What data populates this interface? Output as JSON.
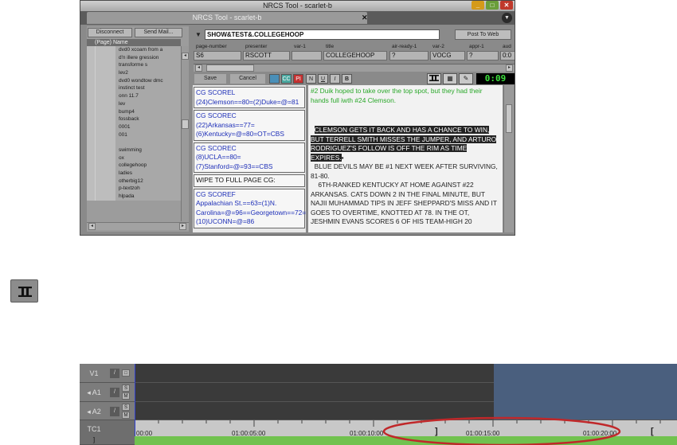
{
  "nrcs": {
    "window_title": "NRCS Tool - scarlet-b",
    "tab_title": "NRCS Tool - scarlet-b",
    "tab_close": "✕",
    "tab_menu": "▼",
    "buttons": {
      "disconnect": "Disconnect",
      "send_mail": "Send Mail..."
    },
    "queue_column_header": "(Page) Name",
    "queue_items": [
      "dvd0 xcoam from a",
      "d'n illere gression",
      "transforme s",
      "lev2",
      "dvd0 wondtow dmc",
      "instinct test",
      "onn 11.7",
      "lev",
      "bump4",
      "fossback",
      "0001",
      "001",
      "",
      "swimming",
      "ox",
      "collegehoop",
      "ladies",
      "otherbig12",
      "p-textzoh",
      "hlpada"
    ],
    "story": {
      "slug": "SHOW&TEST&.COLLEGEHOOP",
      "post_to_web": "Post To Web",
      "dropdown": "▼",
      "fields": [
        {
          "label": "page-number",
          "value": "S6"
        },
        {
          "label": "presenter",
          "value": "RSCOTT"
        },
        {
          "label": "var-1",
          "value": ""
        },
        {
          "label": "title",
          "value": "COLLEGEHOOP"
        },
        {
          "label": "air-ready-1",
          "value": "?"
        },
        {
          "label": "var-2",
          "value": "VOCG"
        },
        {
          "label": "appr-1",
          "value": "?"
        },
        {
          "label": "aud",
          "value": "0:0"
        }
      ]
    },
    "toolbar": {
      "save": "Save",
      "cancel": "Cancel",
      "cc": "CC",
      "pi": "PI",
      "n": "N",
      "u": "U",
      "i": "I",
      "b": "B",
      "timer": "0:09"
    },
    "cg_boxes": [
      "CG SCOREL\n(24)Clemson==80=(2)Duke=@=81",
      "CG SCOREC\n(22)Arkansas==77=(6)Kentucky=@=80=OT=CBS",
      "CG SCOREC\n(8)UCLA==80=(7)Stanford=@=93==CBS",
      "WIPE TO FULL PAGE CG:",
      "CG SCOREF\nAppalachian St.==63=(1)N. Carolina=@=96==Georgetown==72=(10)UCONN=@=86"
    ],
    "script": {
      "green_text": "#2 Duik hoped to take over the top spot, but they had their hands full iwth #24 Clemson.",
      "highlighted_text": "CLEMSON GETS IT BACK AND HAS A CHANCE TO WIN, BUT TERRELL SMITH MISSES THE JUMPER, AND ARTURO RODRIGUEZ'S FOLLOW IS OFF THE RIM AS TIME EXPIRES.",
      "para2": "BLUE DEVILS MAY BE #1 NEXT WEEK AFTER SURVIVING, 81-80.",
      "para3": "6TH-RANKED KENTUCKY AT HOME AGAINST #22 ARKANSAS. CATS DOWN 2 IN THE FINAL MINUTE, BUT NAJII MUHAMMAD TIPS IN JEFF SHEPPARD'S MISS AND IT GOES TO OVERTIME, KNOTTED AT 78. IN THE OT, JESHMIN EVANS SCORES 6 OF HIS TEAM-HIGH 20"
    }
  },
  "timeline": {
    "tracks": [
      {
        "name": "V1",
        "mono": "/",
        "extra": "□"
      },
      {
        "name": "◂ A1",
        "mono": "/",
        "extra": "S M"
      },
      {
        "name": "◂ A2",
        "mono": "/",
        "extra": "S M"
      },
      {
        "name": "TC1",
        "mono": "",
        "extra": ""
      }
    ],
    "timecodes": [
      "00:00",
      "01:00:05:00",
      "01:00:10:00",
      "01:00:15:00",
      "01:00:20:00"
    ],
    "in_mark": "]",
    "out_mark": "[",
    "bottom_marker": "]",
    "highlight_color": "#c0282a"
  }
}
